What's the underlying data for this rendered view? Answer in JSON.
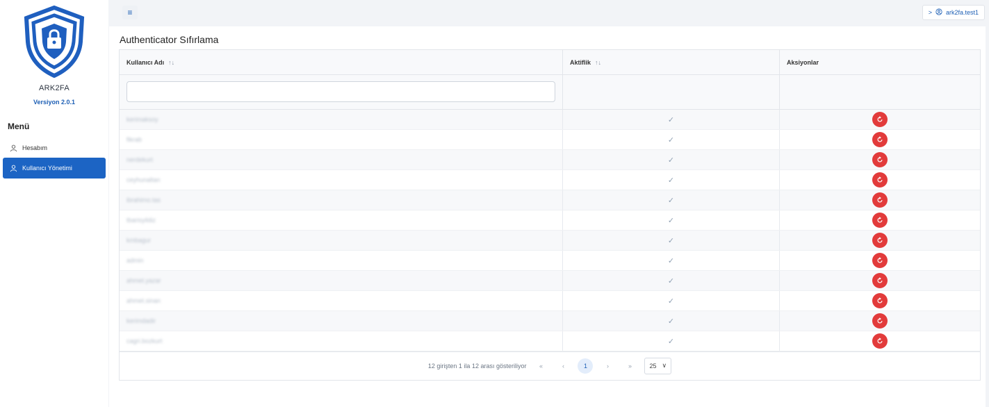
{
  "sidebar": {
    "app_name": "ARK2FA",
    "version": "Versiyon 2.0.1",
    "menu_title": "Menü",
    "items": [
      {
        "label": "Hesabım",
        "icon": "user-icon",
        "active": false
      },
      {
        "label": "Kullanıcı Yönetimi",
        "icon": "user-icon",
        "active": true
      }
    ]
  },
  "topbar": {
    "menu_icon": "hamburger-icon",
    "user_chevron": ">",
    "user_name": "ark2fa.test1"
  },
  "page": {
    "title": "Authenticator Sıfırlama"
  },
  "table": {
    "columns": [
      {
        "label": "Kullanıcı Adı",
        "sortable": true
      },
      {
        "label": "Aktiflik",
        "sortable": true
      },
      {
        "label": "Aksiyonlar",
        "sortable": false
      }
    ],
    "sort_glyph": "↑↓",
    "filter_placeholder": "",
    "check_glyph": "✓",
    "rows": [
      {
        "username": "kerimaksoy",
        "active": true
      },
      {
        "username": "fikrab",
        "active": true
      },
      {
        "username": "nerdekurt",
        "active": true
      },
      {
        "username": "ceyhunaltan",
        "active": true
      },
      {
        "username": "ibrahimo.tas",
        "active": true
      },
      {
        "username": "tbarisyildiz",
        "active": true
      },
      {
        "username": "kmbagur",
        "active": true
      },
      {
        "username": "admin",
        "active": true
      },
      {
        "username": "ahmet.yazar",
        "active": true
      },
      {
        "username": "ahmet.sinan",
        "active": true
      },
      {
        "username": "kerimdadir",
        "active": true
      },
      {
        "username": "cagri.bozkurt",
        "active": true
      }
    ]
  },
  "pagination": {
    "summary": "12 girişten 1 ila 12 arası gösteriliyor",
    "first": "«",
    "prev": "‹",
    "current_page": "1",
    "next": "›",
    "last": "»",
    "per_page": "25"
  },
  "colors": {
    "accent": "#1c64c4",
    "danger": "#e23b3b",
    "logo": "#1f5fbf"
  }
}
